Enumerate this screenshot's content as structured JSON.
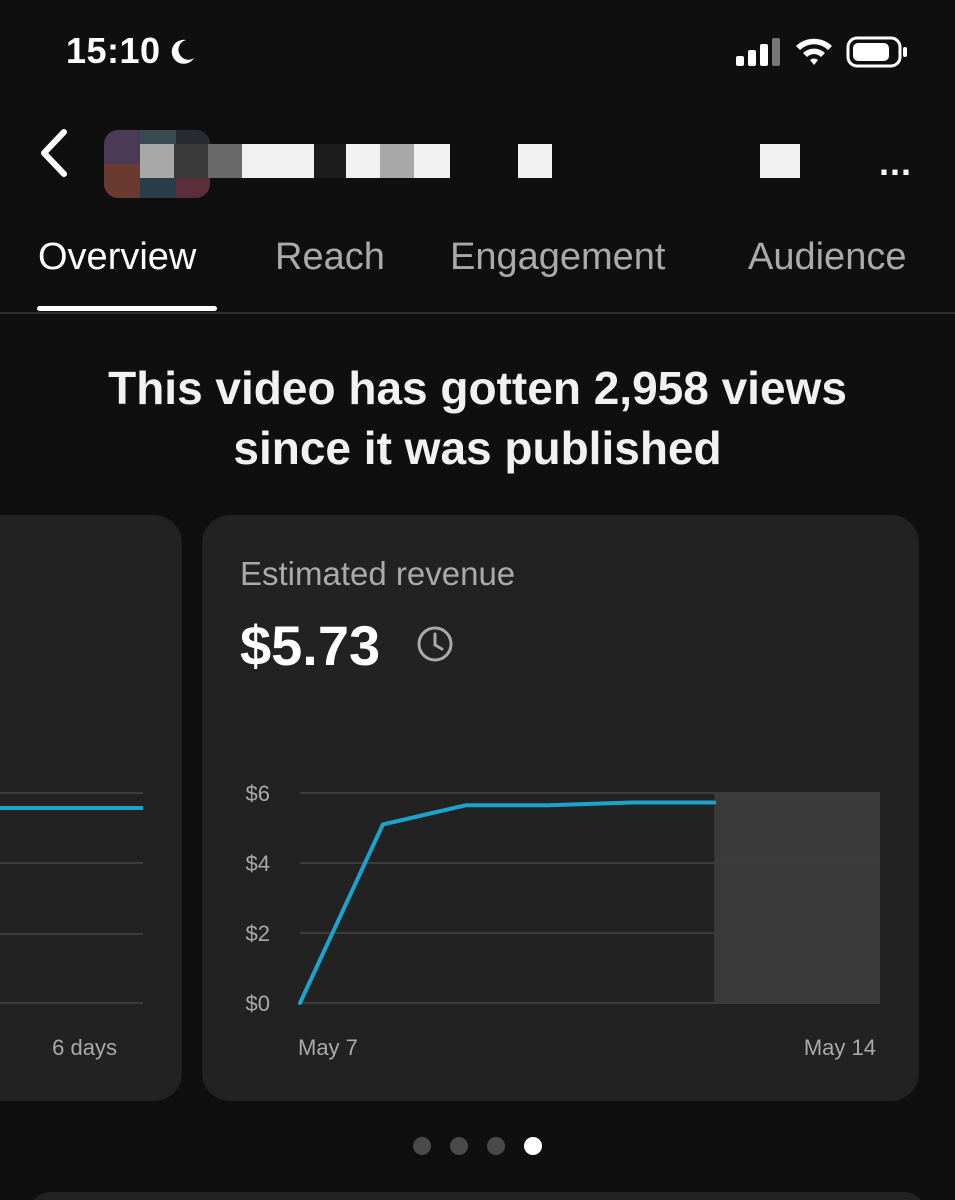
{
  "status_bar": {
    "time": "15:10"
  },
  "header": {
    "title_suffix": "...",
    "back": "back"
  },
  "tabs": [
    {
      "label": "Overview",
      "active": true
    },
    {
      "label": "Reach",
      "active": false
    },
    {
      "label": "Engagement",
      "active": false
    },
    {
      "label": "Audience",
      "active": false
    }
  ],
  "headline": "This video has gotten 2,958 views since it was published",
  "cards": {
    "left": {
      "x_end_label": "6 days"
    },
    "revenue": {
      "label": "Estimated revenue",
      "value": "$5.73"
    }
  },
  "pagination": {
    "count": 4,
    "active_index": 3
  },
  "colors": {
    "line": "#1ba3cc",
    "accent": "#ffffff"
  },
  "chart_data": [
    {
      "type": "line",
      "title": "",
      "x": [
        "May 7",
        "May 8",
        "May 9",
        "May 10",
        "May 11",
        "May 12"
      ],
      "values": [
        0.0,
        5.1,
        5.65,
        5.65,
        5.73,
        5.73
      ],
      "y_ticks": [
        "$0",
        "$2",
        "$4",
        "$6"
      ],
      "ylim": [
        0,
        6
      ],
      "x_tick_labels": [
        "May 7",
        "May 14"
      ],
      "grid": true,
      "shaded_region": {
        "from": "May 12",
        "to": "May 14"
      }
    }
  ]
}
